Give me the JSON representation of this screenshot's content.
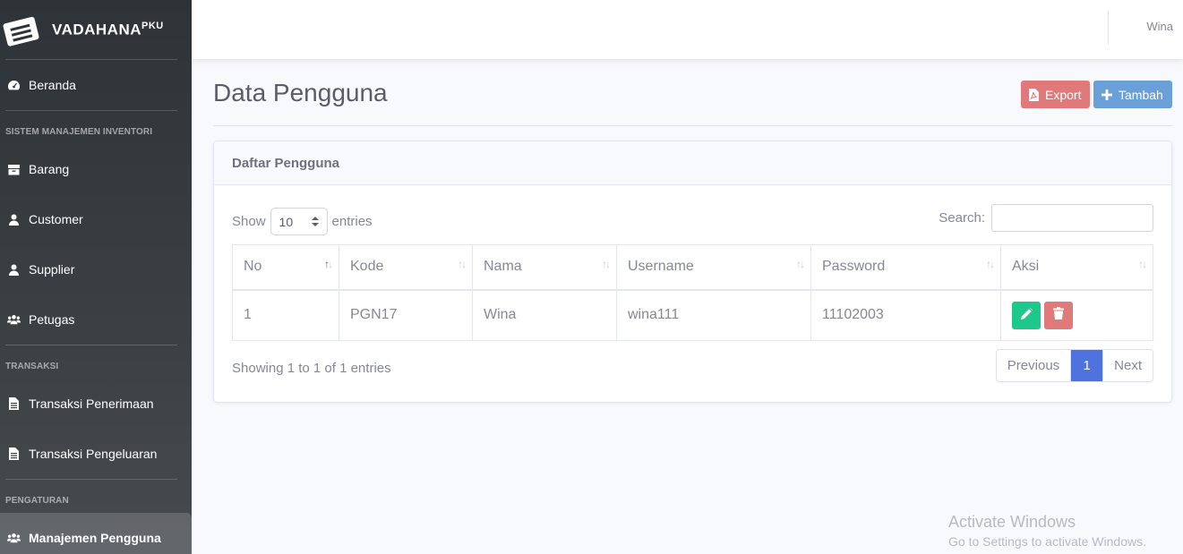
{
  "brand": {
    "name": "VADAHANA",
    "suffix": "PKU"
  },
  "topbar": {
    "user": "Wina"
  },
  "sidebar": {
    "home": "Beranda",
    "heading_inventory": "SISTEM MANAJEMEN INVENTORI",
    "items_inventory": [
      "Barang",
      "Customer",
      "Supplier",
      "Petugas"
    ],
    "heading_transaction": "TRANSAKSI",
    "items_transaction": [
      "Transaksi Penerimaan",
      "Transaksi Pengeluaran"
    ],
    "heading_settings": "PENGATURAN",
    "items_settings": [
      "Manajemen Pengguna"
    ]
  },
  "page": {
    "title": "Data Pengguna",
    "export_label": "Export",
    "add_label": "Tambah"
  },
  "card": {
    "title": "Daftar Pengguna",
    "show_label": "Show",
    "entries_value": "10",
    "entries_label": "entries",
    "search_label": "Search:",
    "columns": [
      "No",
      "Kode",
      "Nama",
      "Username",
      "Password",
      "Aksi"
    ],
    "rows": [
      [
        "1",
        "PGN17",
        "Wina",
        "wina111",
        "11102003"
      ]
    ],
    "info": "Showing 1 to 1 of 1 entries",
    "pager": {
      "previous": "Previous",
      "current": "1",
      "next": "Next"
    }
  },
  "watermark": {
    "line1": "Activate Windows",
    "line2": "Go to Settings to activate Windows."
  }
}
